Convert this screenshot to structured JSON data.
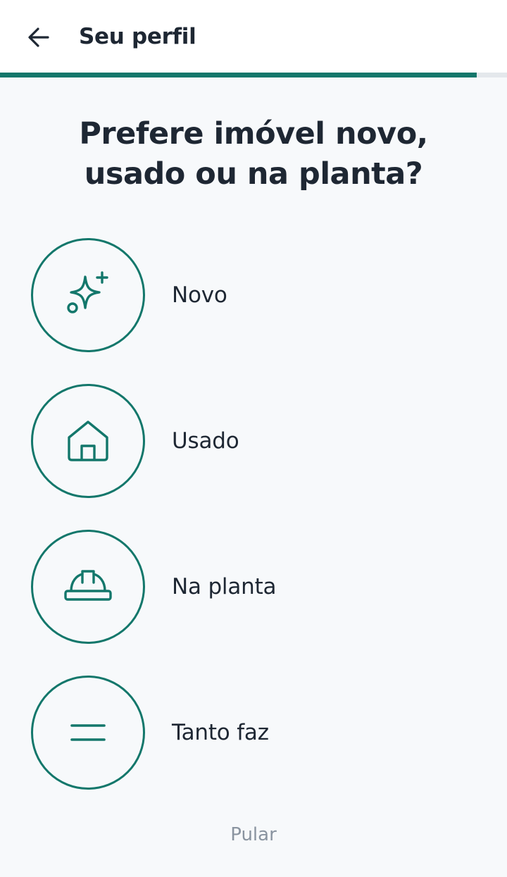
{
  "header": {
    "back_icon": "arrow-left-icon",
    "title": "Seu perfil"
  },
  "progress": {
    "fraction": 0.94,
    "color": "#13776b"
  },
  "question": {
    "line1": "Prefere imóvel novo,",
    "line2": "usado ou na planta?"
  },
  "options": [
    {
      "label": "Novo",
      "icon": "sparkles-icon"
    },
    {
      "label": "Usado",
      "icon": "house-icon"
    },
    {
      "label": "Na planta",
      "icon": "hard-hat-icon"
    },
    {
      "label": "Tanto faz",
      "icon": "equals-icon"
    }
  ],
  "skip_label": "Pular",
  "colors": {
    "accent": "#13776b",
    "text": "#1e2733",
    "muted": "#8a94a0",
    "background": "#f7f9fb"
  }
}
